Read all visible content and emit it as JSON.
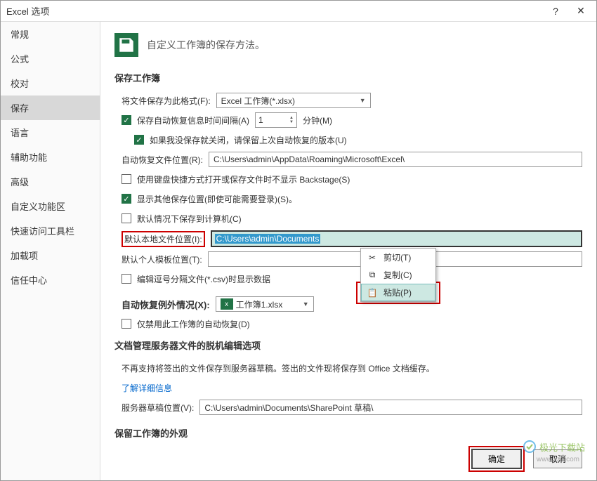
{
  "title": "Excel 选项",
  "sidebar": {
    "items": [
      "常规",
      "公式",
      "校对",
      "保存",
      "语言",
      "辅助功能",
      "高级",
      "自定义功能区",
      "快速访问工具栏",
      "加载项",
      "信任中心"
    ],
    "active_index": 3
  },
  "header": {
    "text": "自定义工作簿的保存方法。"
  },
  "section_save": {
    "title": "保存工作簿",
    "save_format_label": "将文件保存为此格式(F):",
    "save_format_value": "Excel 工作簿(*.xlsx)",
    "autosave_check": "保存自动恢复信息时间间隔(A)",
    "autosave_value": "1",
    "autosave_unit": "分钟(M)",
    "keep_last_check": "如果我没保存就关闭，请保留上次自动恢复的版本(U)",
    "autorecover_loc_label": "自动恢复文件位置(R):",
    "autorecover_loc_value": "C:\\Users\\admin\\AppData\\Roaming\\Microsoft\\Excel\\",
    "backstage_check": "使用键盘快捷方式打开或保存文件时不显示 Backstage(S)",
    "show_other_check": "显示其他保存位置(即使可能需要登录)(S)。",
    "save_to_computer_check": "默认情况下保存到计算机(C)",
    "default_loc_label": "默认本地文件位置(I):",
    "default_loc_value": "C:\\Users\\admin\\Documents",
    "template_loc_label": "默认个人模板位置(T):",
    "csv_check": "编辑逗号分隔文件(*.csv)时显示数据"
  },
  "context_menu": {
    "cut": "剪切(T)",
    "copy": "复制(C)",
    "paste": "粘贴(P)"
  },
  "section_except": {
    "title": "自动恢复例外情况(X):",
    "workbook": "工作簿1.xlsx",
    "disable_check": "仅禁用此工作簿的自动恢复(D)"
  },
  "section_doc": {
    "title": "文档管理服务器文件的脱机编辑选项",
    "info": "不再支持将签出的文件保存到服务器草稿。签出的文件现将保存到 Office 文档缓存。",
    "link": "了解详细信息",
    "draft_label": "服务器草稿位置(V):",
    "draft_value": "C:\\Users\\admin\\Documents\\SharePoint 草稿\\"
  },
  "section_appearance": {
    "title": "保留工作簿的外观"
  },
  "footer": {
    "ok": "确定",
    "cancel": "取消"
  },
  "watermark": {
    "text": "极光下载站",
    "url": "www.xz7.com"
  }
}
